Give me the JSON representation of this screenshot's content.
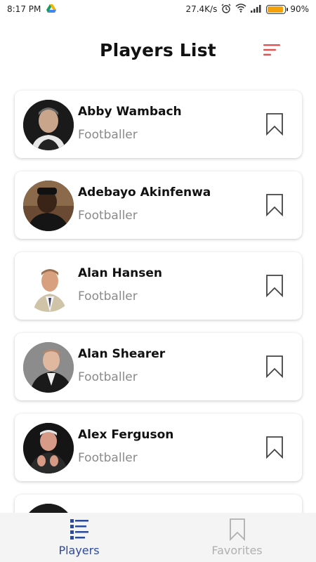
{
  "status_bar": {
    "time": "8:17 PM",
    "network_speed": "27.4K/s",
    "battery_percent": "90%",
    "battery_level": 0.9,
    "battery_color": "#f4a20c"
  },
  "header": {
    "title": "Players List",
    "filter_icon": "sort-icon",
    "accent_color": "#e05252"
  },
  "players": [
    {
      "name": "Abby Wambach",
      "role": "Footballer"
    },
    {
      "name": "Adebayo Akinfenwa",
      "role": "Footballer"
    },
    {
      "name": "Alan Hansen",
      "role": "Footballer"
    },
    {
      "name": "Alan Shearer",
      "role": "Footballer"
    },
    {
      "name": "Alex Ferguson",
      "role": "Footballer"
    }
  ],
  "bottom_nav": {
    "tabs": [
      {
        "label": "Players",
        "icon": "players-list-icon",
        "active": true
      },
      {
        "label": "Favorites",
        "icon": "bookmark-icon",
        "active": false
      }
    ],
    "active_color": "#2c4a9c",
    "inactive_color": "#b0b0b0"
  }
}
